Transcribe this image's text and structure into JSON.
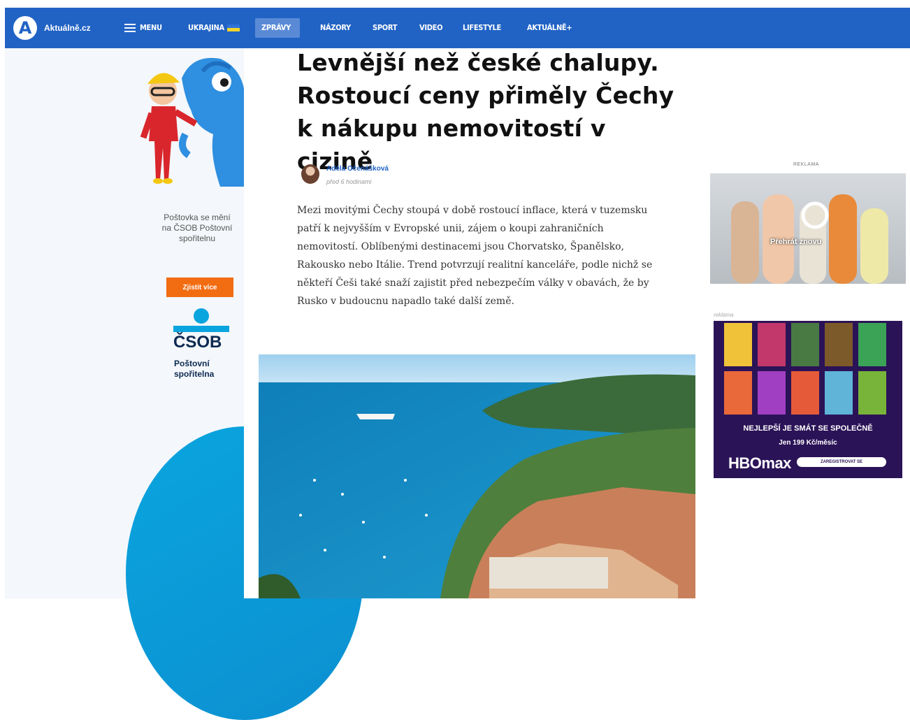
{
  "nav": {
    "brand": "Aktuálně.cz",
    "items": [
      {
        "label": "MENU"
      },
      {
        "label": "UKRAJINA"
      },
      {
        "label": "ZPRÁVY"
      },
      {
        "label": "NÁZORY"
      },
      {
        "label": "SPORT"
      },
      {
        "label": "VIDEO"
      },
      {
        "label": "LIFESTYLE"
      },
      {
        "label": "AKTUÁLNĚ+"
      }
    ],
    "active": "ZPRÁVY",
    "accent": "#2163c5"
  },
  "promo": {
    "text": "Poštovka se mění na ČSOB Poštovní spořitelnu",
    "button": "Zjistit více",
    "logo_word": "ČSOB",
    "logo_sub": "Poštovní spořitelna"
  },
  "article": {
    "headline": "Levnější než české chalupy. Rostoucí ceny přiměly Čechy k nákupu nemovitostí v cizině",
    "author": "Adéla Očenášková",
    "time": "před 6 hodinami",
    "perex": "Mezi movitými Čechy stoupá v době rostoucí inflace, která v tuzemsku patří k nejvyšším v Evropské unii, zájem o koupi zahraničních nemovitostí. Oblíbenými destinacemi jsou Chorvatsko, Španělsko, Rakousko nebo Itálie. Trend potvrzují realitní kanceláře, podle nichž se někteří Češi také snaží zajistit před nebezpečím války v obavách, že by Rusko v budoucnu napadlo také další země."
  },
  "ads": {
    "label_top": "REKLAMA",
    "video_replay": "Přehrát znovu",
    "label_side": "reklama",
    "hbo_tagline": "NEJLEPŠÍ JE SMÁT SE SPOLEČNĚ",
    "hbo_price": "Jen 199 Kč/měsíc",
    "hbo_logo": "HBOmax",
    "hbo_cta": "ZAREGISTROVAT SE"
  }
}
